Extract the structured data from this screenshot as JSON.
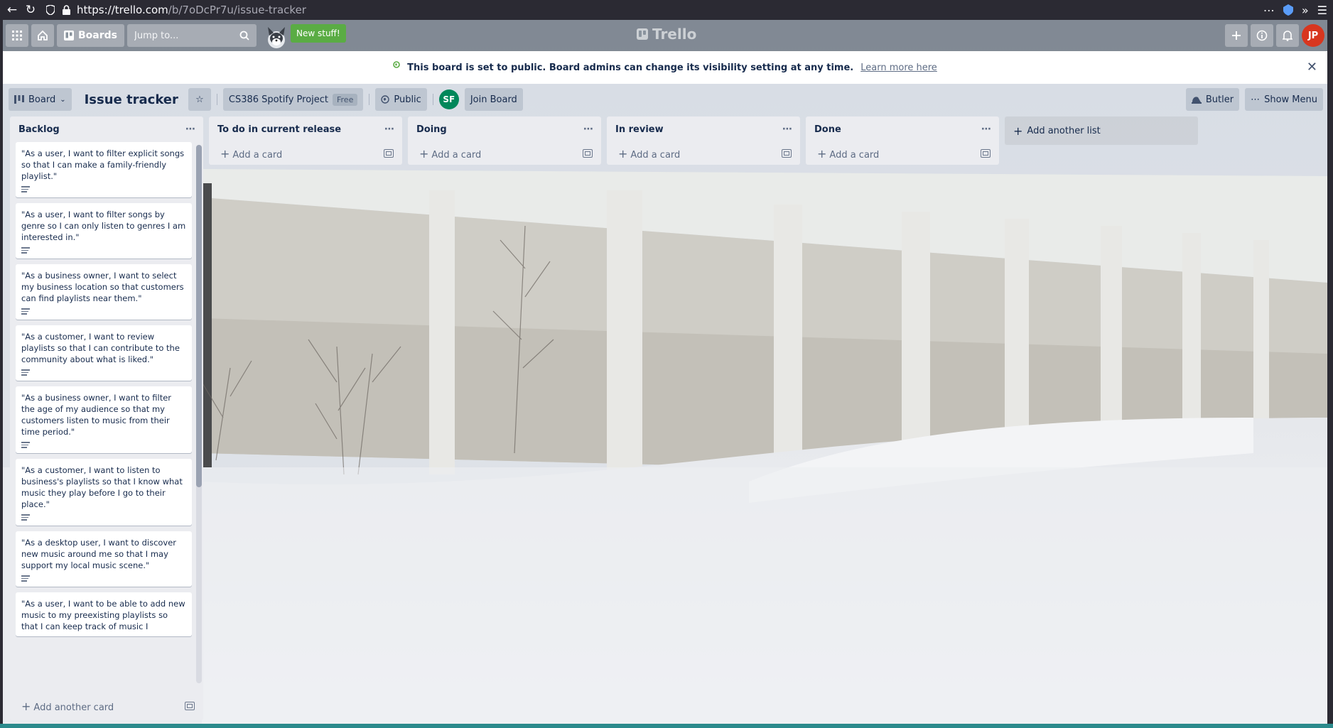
{
  "browser": {
    "url_prefix": "https://trello.com",
    "url_path": "/b/7oDcPr7u/issue-tracker"
  },
  "header": {
    "boards_label": "Boards",
    "search_placeholder": "Jump to...",
    "new_stuff_label": "New stuff!",
    "logo_text": "Trello",
    "avatar_initials": "JP"
  },
  "banner": {
    "message": "This board is set to public. Board admins can change its visibility setting at any time.",
    "link_text": "Learn more here"
  },
  "board_header": {
    "view_label": "Board",
    "title": "Issue tracker",
    "team_name": "CS386 Spotify Project",
    "team_badge": "Free",
    "visibility_label": "Public",
    "member_initials": "SF",
    "join_label": "Join Board",
    "butler_label": "Butler",
    "show_menu_label": "Show Menu"
  },
  "lists": [
    {
      "title": "Backlog",
      "add_card_label": "Add another card",
      "cards": [
        "\"As a user, I want to filter explicit songs so that I can make a family-friendly playlist.\"",
        "\"As a user, I want to filter songs by genre so I can only listen to genres I am interested in.\"",
        "\"As a business owner, I want to select my business location so that customers can find playlists near them.\"",
        "\"As a customer, I want to review playlists so that I can contribute to the community about what is liked.\"",
        "\"As a business owner, I want to filter the age of my audience so that my customers listen to music from their time period.\"",
        "\"As a customer, I want to listen to business's playlists so that I know what music they play before I go to their place.\"",
        "\"As a desktop user, I want to discover new music around me so that I may support my local music scene.\"",
        "\"As a user, I want to be able to add new music to my preexisting playlists so that I can keep track of music I"
      ]
    },
    {
      "title": "To do in current release",
      "add_card_label": "Add a card"
    },
    {
      "title": "Doing",
      "add_card_label": "Add a card"
    },
    {
      "title": "In review",
      "add_card_label": "Add a card"
    },
    {
      "title": "Done",
      "add_card_label": "Add a card"
    }
  ],
  "add_list_label": "Add another list",
  "colors": {
    "header_bg": "#717a85",
    "new_stuff": "#5aac44",
    "list_bg": "#ebecf0",
    "avatar_jp": "#d8361f",
    "avatar_sf": "#00875a"
  }
}
